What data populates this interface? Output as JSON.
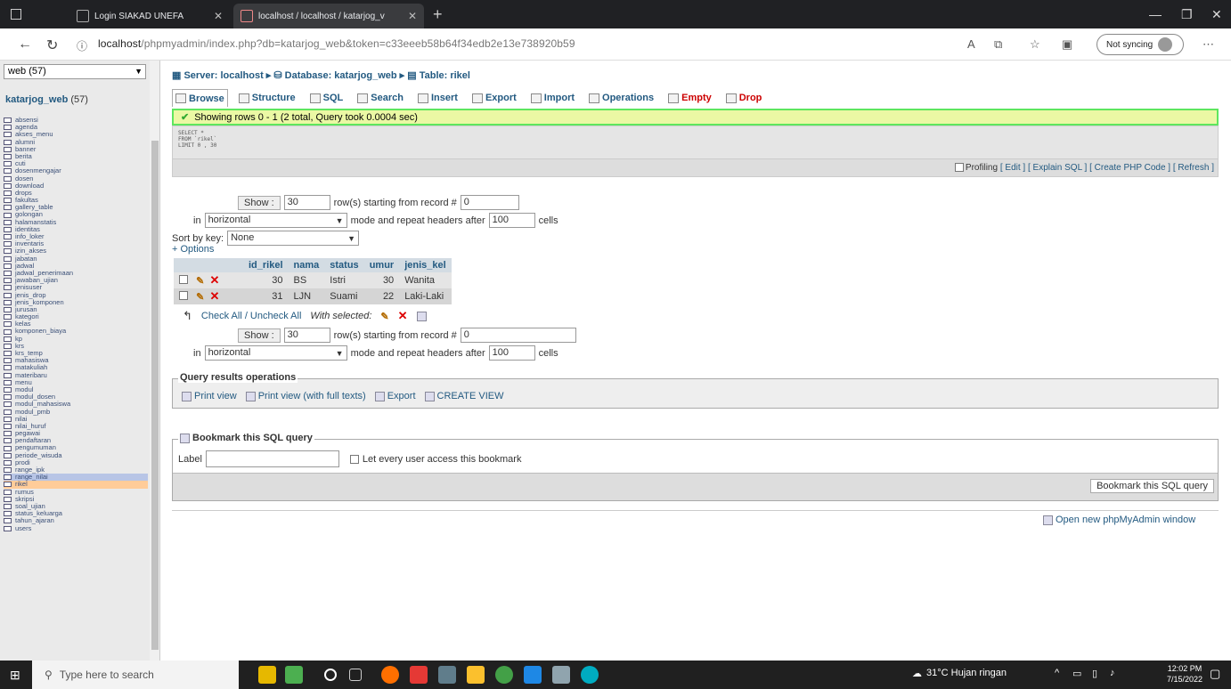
{
  "browser": {
    "tabs": [
      {
        "label": "Login SIAKAD UNEFA"
      },
      {
        "label": "localhost / localhost / katarjog_v"
      }
    ],
    "url_host": "localhost",
    "url_rest": "/phpmyadmin/index.php?db=katarjog_web&token=c33eeeb58b64f34edb2e13e738920b59",
    "not_syncing": "Not syncing"
  },
  "sidebar": {
    "db_select": "web (57)",
    "db_title": "katarjog_web",
    "db_count": "(57)",
    "tables": [
      "absensi",
      "agenda",
      "akses_menu",
      "alumni",
      "banner",
      "berita",
      "cuti",
      "dosenmengajar",
      "dosen",
      "download",
      "drops",
      "fakultas",
      "gallery_table",
      "golongan",
      "halamanstatis",
      "identitas",
      "info_loker",
      "inventaris",
      "izin_akses",
      "jabatan",
      "jadwal",
      "jadwal_penerimaan",
      "jawaban_ujian",
      "jenisuser",
      "jenis_drop",
      "jenis_komponen",
      "jurusan",
      "kategori",
      "kelas",
      "komponen_biaya",
      "kp",
      "krs",
      "krs_temp",
      "mahasiswa",
      "matakuliah",
      "materibaru",
      "menu",
      "modul",
      "modul_dosen",
      "modul_mahasiswa",
      "modul_pmb",
      "nilai",
      "nilai_huruf",
      "pegawai",
      "pendaftaran",
      "pengumuman",
      "periode_wisuda",
      "prodi",
      "range_ipk",
      "range_nilai",
      "rikel",
      "rumus",
      "skripsi",
      "soal_ujian",
      "status_keluarga",
      "tahun_ajaran",
      "users"
    ]
  },
  "breadcrumb": {
    "server": "Server: localhost",
    "database": "Database: katarjog_web",
    "table": "Table: rikel"
  },
  "tabs": [
    "Browse",
    "Structure",
    "SQL",
    "Search",
    "Insert",
    "Export",
    "Import",
    "Operations",
    "Empty",
    "Drop"
  ],
  "result": {
    "message": "Showing rows 0 - 1 (2 total, Query took 0.0004 sec)",
    "sql_lines": [
      "SELECT *",
      "FROM `rikel`",
      "LIMIT 0 , 30"
    ],
    "profiling": "Profiling",
    "links": [
      "[ Edit ]",
      "[ Explain SQL ]",
      "[ Create PHP Code ]",
      "[ Refresh ]"
    ]
  },
  "nav": {
    "show": "Show :",
    "rows": "30",
    "starting": "row(s) starting from record #",
    "record": "0",
    "in": "in",
    "mode": "horizontal",
    "mode_text": "mode and repeat headers after",
    "repeat": "100",
    "cells": "cells",
    "sort_label": "Sort by key:",
    "sort_value": "None",
    "options": "+ Options"
  },
  "table": {
    "columns": [
      "id_rikel",
      "nama",
      "status",
      "umur",
      "jenis_kel"
    ],
    "rows": [
      {
        "id": "30",
        "nama": "BS",
        "status": "Istri",
        "umur": "30",
        "jenis": "Wanita"
      },
      {
        "id": "31",
        "nama": "LJN",
        "status": "Suami",
        "umur": "22",
        "jenis": "Laki-Laki"
      }
    ],
    "check_all": "Check All / Uncheck All",
    "with_selected": "With selected:"
  },
  "query_ops": {
    "legend": "Query results operations",
    "print_view": "Print view",
    "print_full": "Print view (with full texts)",
    "export": "Export",
    "create_view": "CREATE VIEW"
  },
  "bookmark": {
    "legend": "Bookmark this SQL query",
    "label": "Label",
    "every_user": "Let every user access this bookmark",
    "button": "Bookmark this SQL query"
  },
  "open_new": "Open new phpMyAdmin window",
  "taskbar": {
    "search": "Type here to search",
    "weather": "31°C Hujan ringan",
    "time": "12:02 PM",
    "date": "7/15/2022"
  }
}
